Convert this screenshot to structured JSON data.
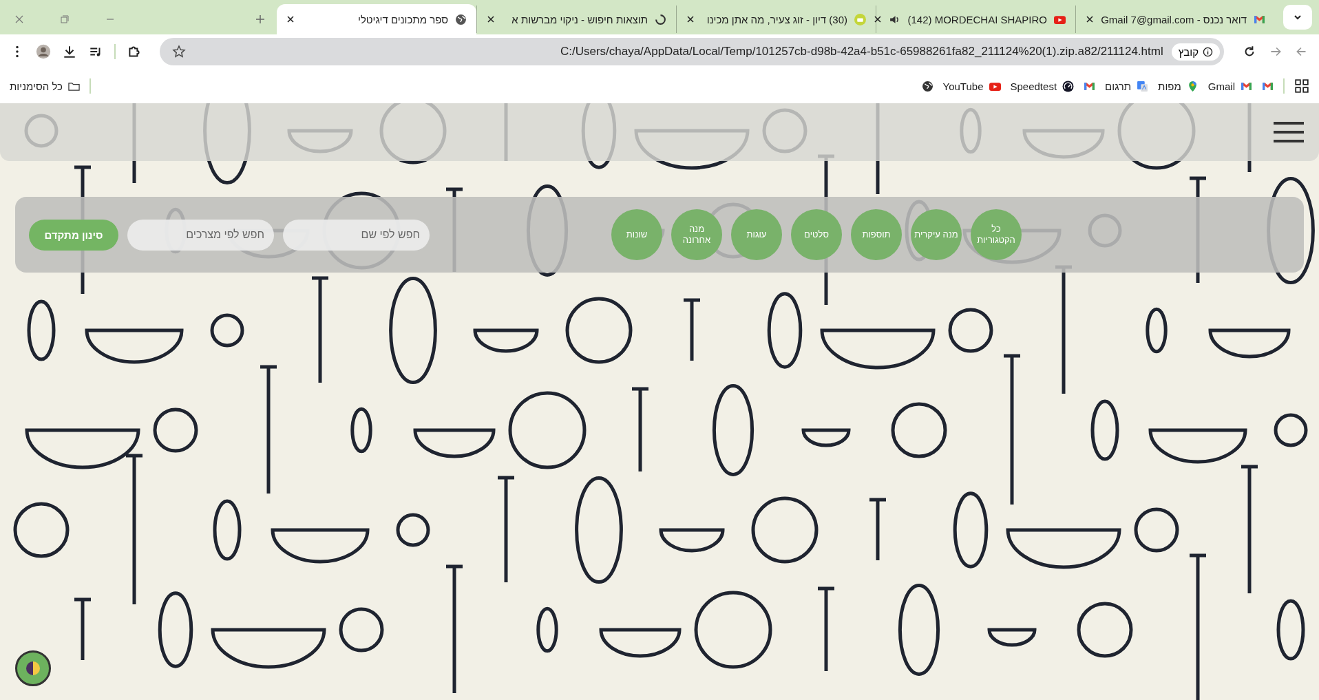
{
  "tabs": [
    {
      "title": "דואר נכנס - Gmail ‎7@gmail.com",
      "kind": "gmail",
      "playing": false,
      "selected": false
    },
    {
      "title": "(142) MORDECHAI SHAPIRO",
      "kind": "youtube",
      "playing": true,
      "selected": false
    },
    {
      "title": "(30) דיון - זוג צעיר, מה אתן מכינו",
      "kind": "forum",
      "playing": false,
      "selected": false
    },
    {
      "title": "תוצאות חיפוש - ניקוי מברשות א",
      "kind": "loading",
      "playing": false,
      "selected": false
    },
    {
      "title": "ספר מתכונים דיגיטלי",
      "kind": "globe",
      "playing": false,
      "selected": true
    }
  ],
  "address_bar": {
    "site_chip": "קובץ",
    "url": "C:/Users/chaya/AppData/Local/Temp/101257cb-d98b-42a4-b51c-65988261fa82_211124%20(1).zip.a82/211124.html"
  },
  "bookmarks": [
    {
      "kind": "gmail"
    },
    {
      "label": "Gmail",
      "kind": "gmail"
    },
    {
      "label": "מפות",
      "kind": "maps"
    },
    {
      "label": "תרגום",
      "kind": "translate"
    },
    {
      "kind": "gmail"
    },
    {
      "label": "Speedtest",
      "kind": "speedtest"
    },
    {
      "label": "YouTube",
      "kind": "youtube"
    },
    {
      "kind": "globe"
    }
  ],
  "all_bookmarks": "כל הסימניות",
  "page": {
    "categories": [
      "כל הקטגוריות",
      "מנה עיקרית",
      "תוספות",
      "סלטים",
      "עוגות",
      "מנה אחרונה",
      "שונות"
    ],
    "search_name": {
      "placeholder": "חפש לפי שם"
    },
    "search_ingredients": {
      "placeholder": "חפש לפי מצרכים"
    },
    "advanced_filter": "סינון מתקדם"
  }
}
